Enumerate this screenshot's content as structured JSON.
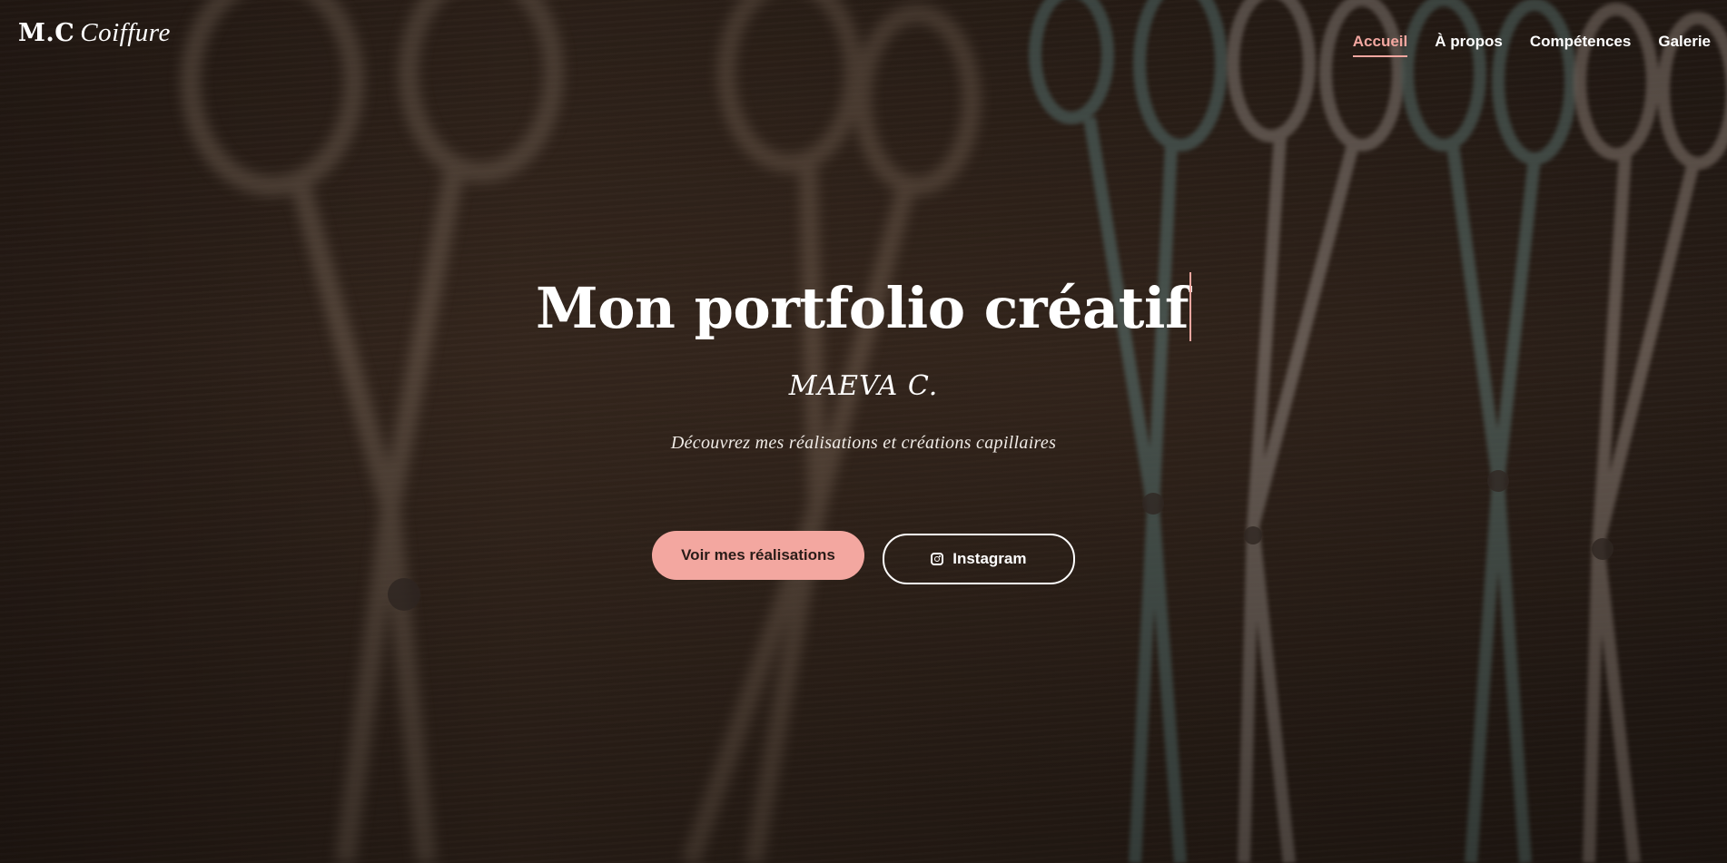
{
  "header": {
    "logo_main": "M.C",
    "logo_script": "Coiffure",
    "nav": [
      {
        "label": "Accueil",
        "active": true
      },
      {
        "label": "À propos",
        "active": false
      },
      {
        "label": "Compétences",
        "active": false
      },
      {
        "label": "Galerie",
        "active": false
      }
    ]
  },
  "hero": {
    "title": "Mon portfolio créatif",
    "name": "MAEVA C.",
    "tagline": "Découvrez mes réalisations et créations capillaires",
    "primary_button": "Voir mes réalisations",
    "secondary_button": "Instagram",
    "secondary_icon": "instagram-icon",
    "background_image": "scissors-on-wood-photo"
  },
  "colors": {
    "accent": "#f3a7a0",
    "text": "#ffffff",
    "background": "#2e221b"
  }
}
